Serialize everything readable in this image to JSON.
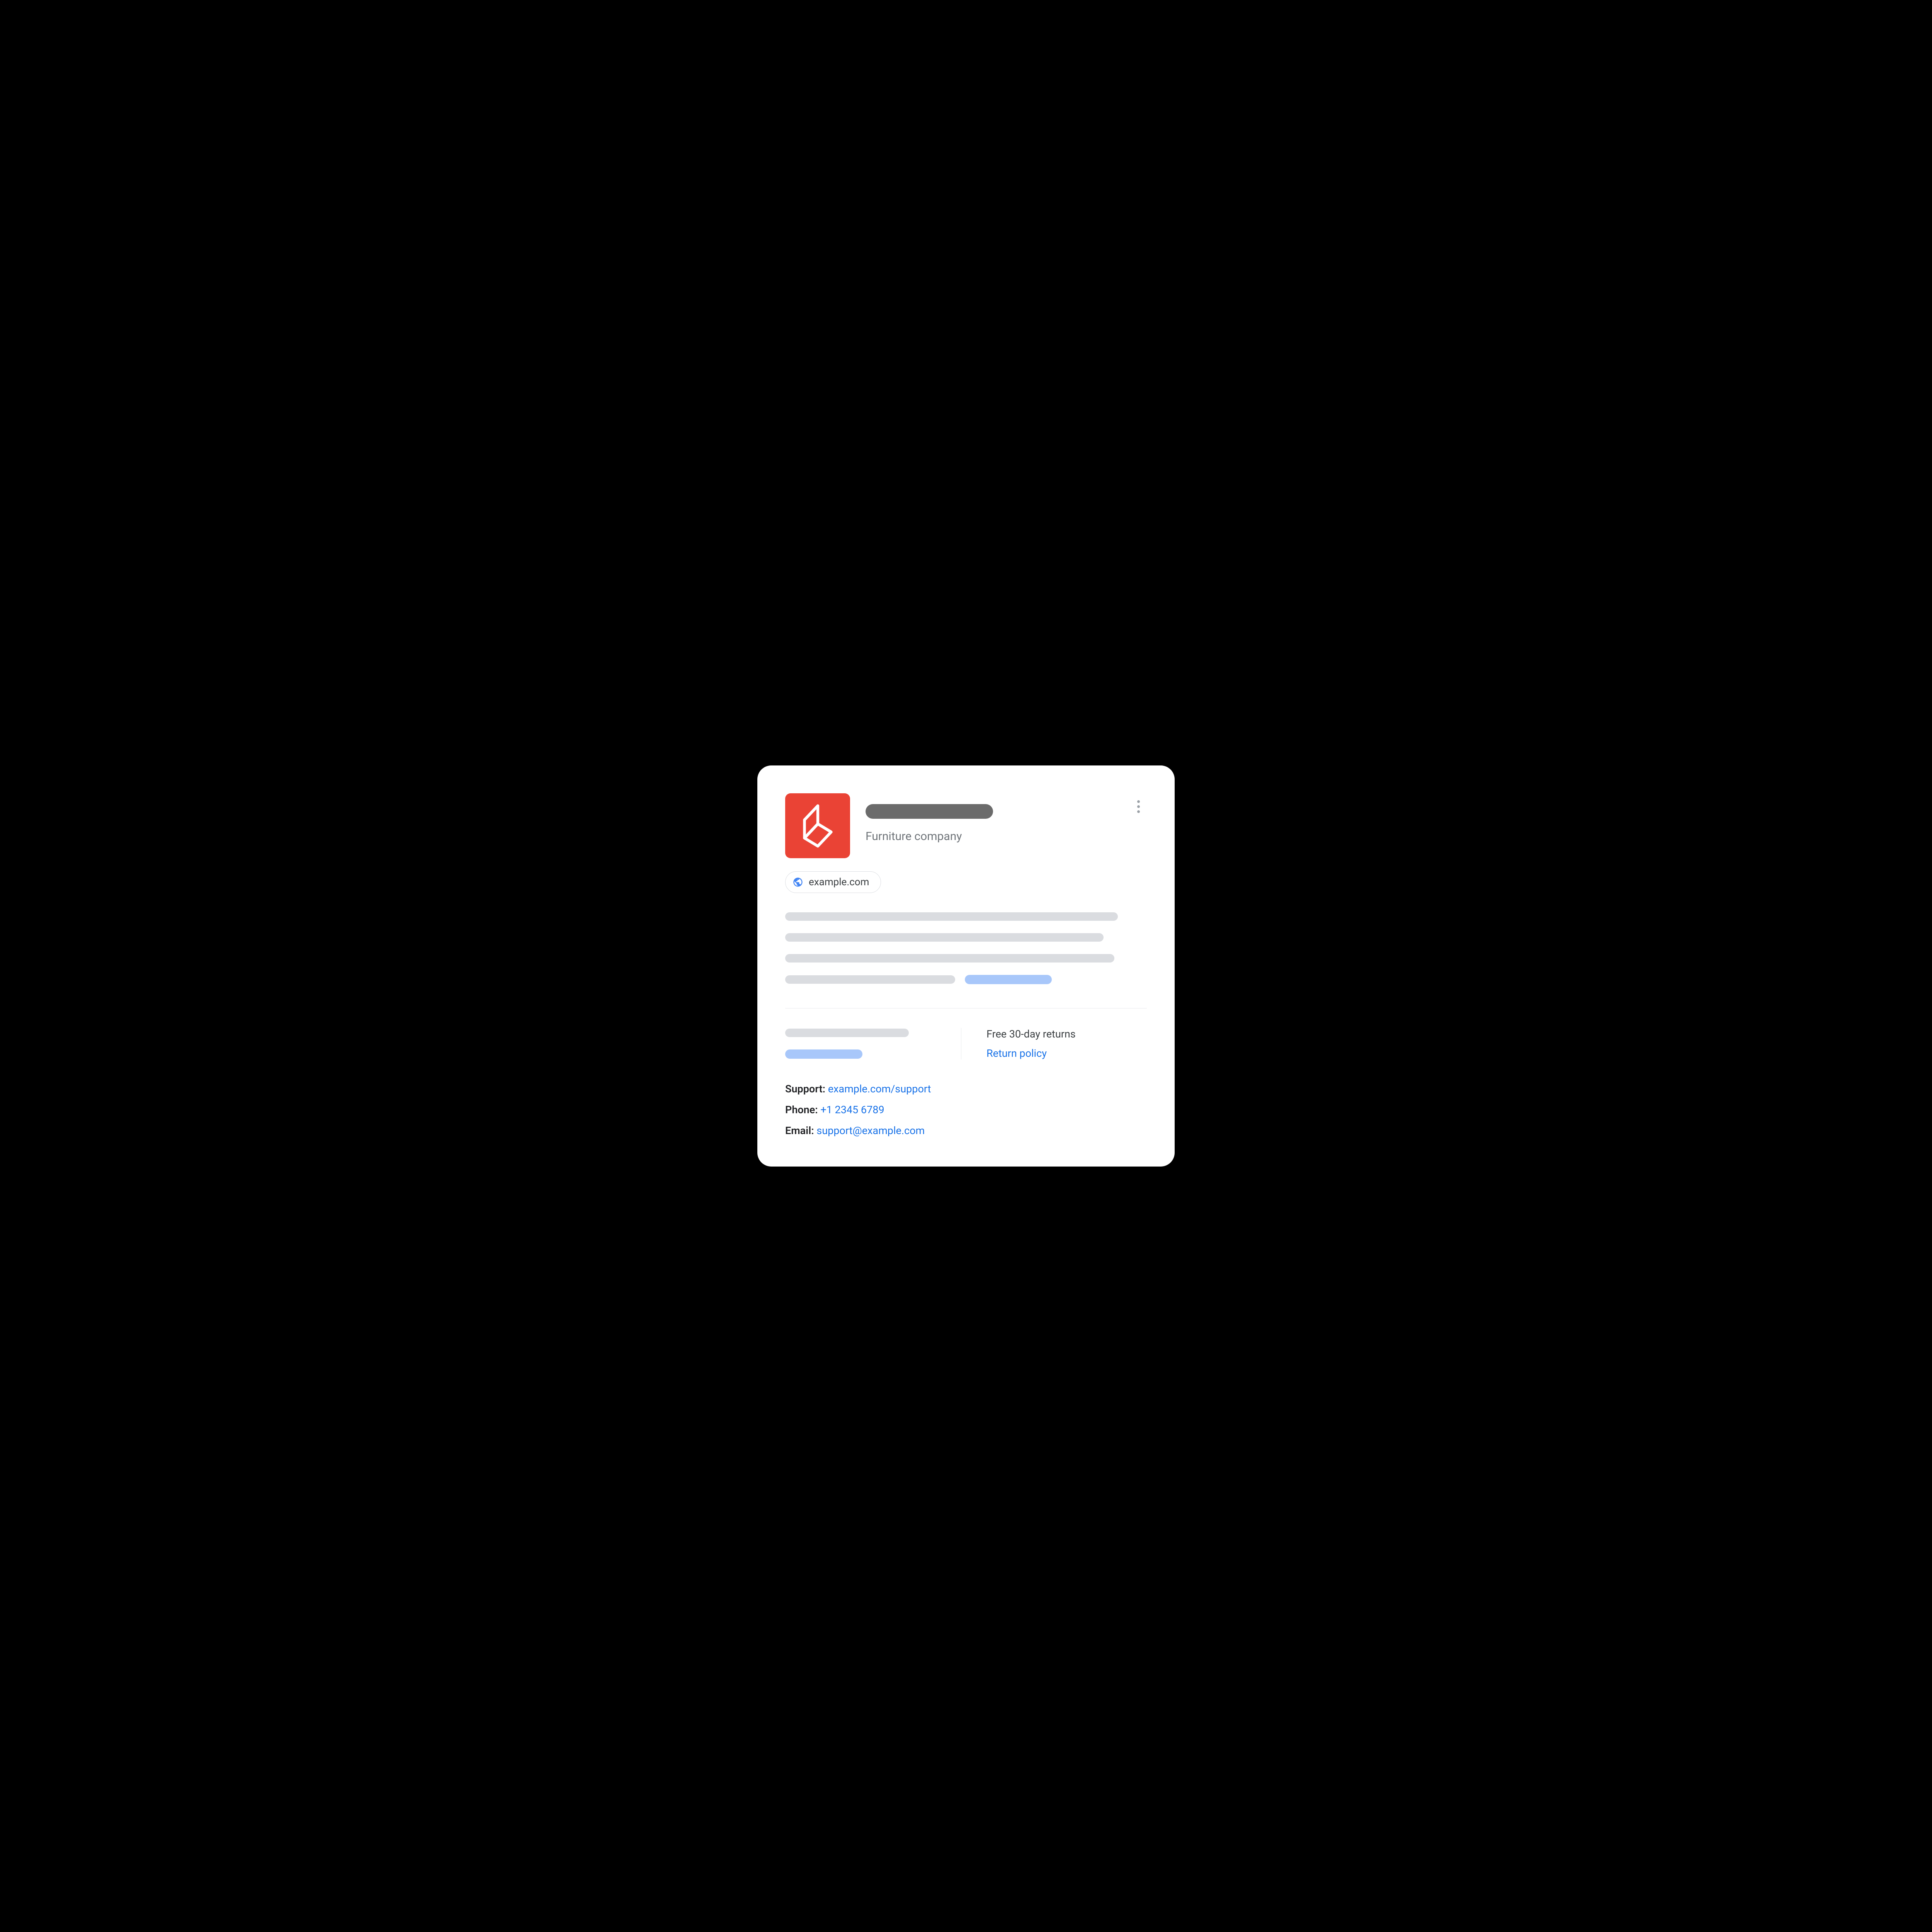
{
  "header": {
    "subtitle": "Furniture company"
  },
  "website": {
    "domain": "example.com"
  },
  "returns": {
    "text": "Free 30-day returns",
    "policy_link": "Return policy"
  },
  "contact": {
    "support_label": "Support:",
    "support_link": "example.com/support",
    "phone_label": "Phone:",
    "phone_link": "+1 2345 6789",
    "email_label": "Email:",
    "email_link": "support@example.com"
  }
}
